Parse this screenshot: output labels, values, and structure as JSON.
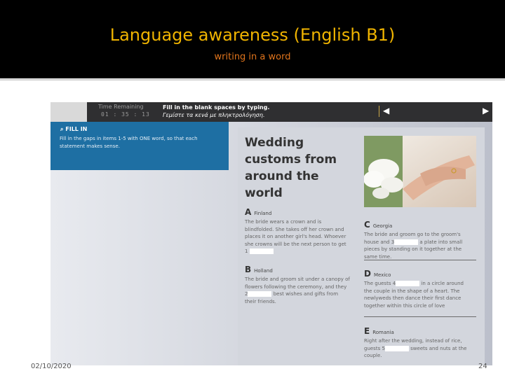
{
  "slide": {
    "title": "Language awareness (English B1)",
    "subtitle": "writing in a word",
    "date": "02/10/2020",
    "page_number": "24"
  },
  "exercise": {
    "timer_label": "Time Remaining",
    "timer": "01 : 35 : 13",
    "instruction_en": "Fill in the blank spaces by typing.",
    "instruction_gr": "Γεμίστε τα κενά με πληκτρολόγηση.",
    "prev_icon": "◀",
    "next_icon": "▶",
    "panel_title": "FILL IN",
    "panel_text": "Fill in the gaps in items 1-5 with ONE word, so that each statement makes sense.",
    "heading": "Wedding customs from around the world",
    "sections": {
      "a": {
        "letter": "A",
        "country": "Finland",
        "text": "The bride wears a crown and is blindfolded. She takes off her crown and places it on another girl's head. Whoever she crowns will be the next person to get 1",
        "gap_value": "",
        "text_after": ""
      },
      "b": {
        "letter": "B",
        "country": "Holland",
        "text": "The bride and groom sit under a canopy of flowers following the ceremony, and they 2",
        "gap_value": "",
        "text_after": "best wishes and gifts from their friends."
      },
      "c": {
        "letter": "C",
        "country": "Georgia",
        "text": "The bride and groom go to the groom's house and 3",
        "gap_value": "",
        "text_after": "a plate into small pieces by standing on it together at the same time."
      },
      "d": {
        "letter": "D",
        "country": "Mexico",
        "text": "The guests 4",
        "gap_value": "",
        "text_after": "in a circle around the couple in the shape of a heart. The newlyweds then dance their first dance together within this circle of love"
      },
      "e": {
        "letter": "E",
        "country": "Romania",
        "text": "Right after the wedding, instead of rice, guests 5",
        "gap_value": "",
        "text_after": "sweets and nuts at the couple."
      }
    }
  },
  "colors": {
    "title": "#f0b400",
    "subtitle": "#e0741c",
    "panel": "#1e6fa3"
  }
}
